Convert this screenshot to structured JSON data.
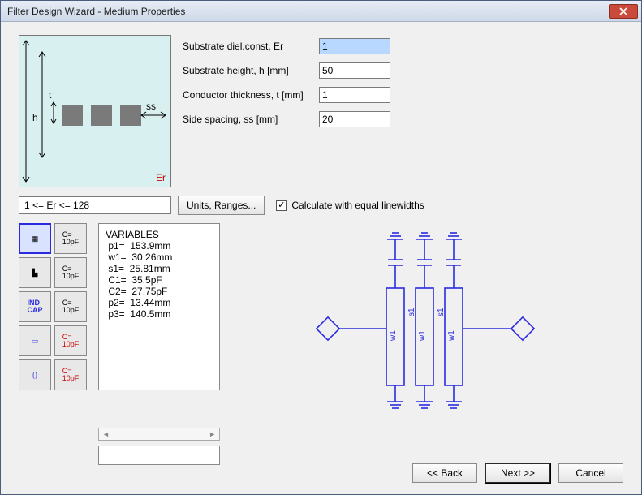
{
  "window": {
    "title": "Filter Design Wizard - Medium Properties"
  },
  "params": {
    "er": {
      "label": "Substrate diel.const, Er",
      "value": "1"
    },
    "h": {
      "label": "Substrate height, h [mm]",
      "value": "50"
    },
    "t": {
      "label": "Conductor thickness, t [mm]",
      "value": "1"
    },
    "ss": {
      "label": "Side spacing, ss [mm]",
      "value": "20"
    }
  },
  "constraint": "1 <= Er <= 128",
  "units_button": "Units, Ranges...",
  "checkbox": {
    "label": "Calculate with equal linewidths",
    "checked": true
  },
  "diagram_labels": {
    "t": "t",
    "h": "h",
    "ss": "ss",
    "er": "Er"
  },
  "palette": {
    "items": [
      {
        "id": "type-1",
        "label": "▦",
        "selected": true
      },
      {
        "id": "cap-10pf-1",
        "label": "C=\n10pF"
      },
      {
        "id": "type-2",
        "label": "▙"
      },
      {
        "id": "cap-10pf-2",
        "label": "C=\n10pF"
      },
      {
        "id": "type-ind-cap",
        "label": "IND\nCAP"
      },
      {
        "id": "cap-10pf-3",
        "label": "C=\n10pF"
      },
      {
        "id": "type-3",
        "label": "▭"
      },
      {
        "id": "cap-10pf-4",
        "label": "C=\n10pF"
      },
      {
        "id": "type-4",
        "label": "⟮⟯"
      },
      {
        "id": "cap-10pf-5",
        "label": "C=\n10pF"
      }
    ]
  },
  "variables": {
    "header": "VARIABLES",
    "lines": [
      " p1=  153.9mm",
      " w1=  30.26mm",
      " s1=  25.81mm",
      " C1=  35.5pF",
      " C2=  27.75pF",
      " p2=  13.44mm",
      " p3=  140.5mm"
    ]
  },
  "schematic_labels": {
    "s1": "s1",
    "w1": "w1"
  },
  "footer": {
    "back": "<< Back",
    "next": "Next >>",
    "cancel": "Cancel"
  }
}
